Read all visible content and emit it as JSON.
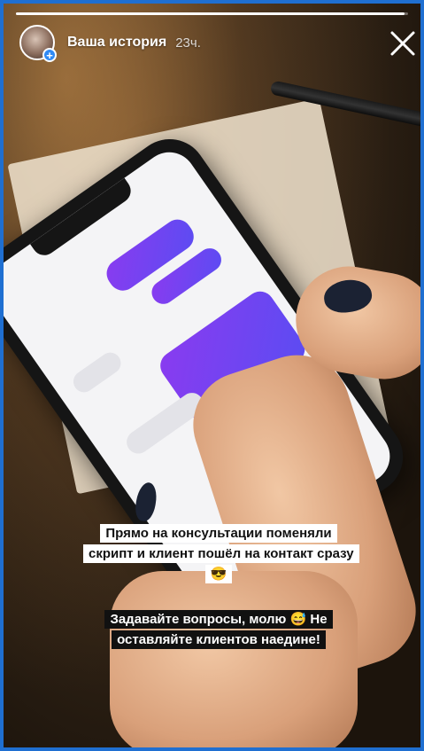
{
  "story": {
    "username": "Ваша история",
    "time_ago": "23ч.",
    "progress": 0.99,
    "close_icon": "close-icon",
    "add_icon": "plus-icon"
  },
  "captions": {
    "primary": "Прямо на консультации поменяли скрипт и клиент пошёл на контакт сразу😎",
    "secondary": "Задавайте вопросы, молю 😅 Не оставляйте клиентов наедине!"
  },
  "colors": {
    "frame": "#1f6fd1",
    "accent": "#2f8af5"
  }
}
